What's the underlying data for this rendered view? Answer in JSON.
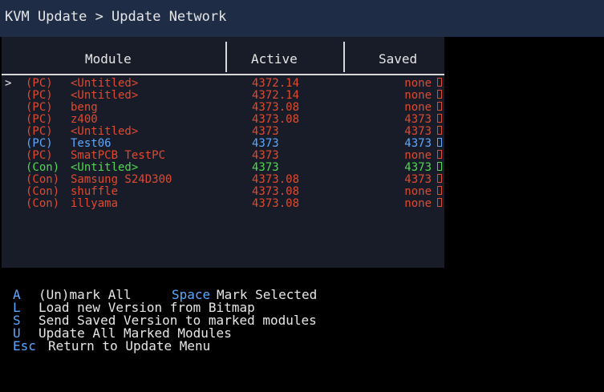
{
  "title": "KVM Update > Update Network",
  "columns": {
    "module": "Module",
    "active": "Active",
    "saved": "Saved"
  },
  "cursor": ">",
  "rows": [
    {
      "type": "(PC)",
      "name": "<Untitled>",
      "active": "4372.14",
      "saved": "none",
      "color": "#e04a2e"
    },
    {
      "type": "(PC)",
      "name": "<Untitled>",
      "active": "4372.14",
      "saved": "none",
      "color": "#e04a2e"
    },
    {
      "type": "(PC)",
      "name": "beng",
      "active": "4373.08",
      "saved": "none",
      "color": "#e04a2e"
    },
    {
      "type": "(PC)",
      "name": "z400",
      "active": "4373.08",
      "saved": "4373",
      "color": "#e04a2e"
    },
    {
      "type": "(PC)",
      "name": "<Untitled>",
      "active": "4373",
      "saved": "4373",
      "color": "#e04a2e"
    },
    {
      "type": "(PC)",
      "name": "Test06",
      "active": "4373",
      "saved": "4373",
      "color": "#5aa8ff"
    },
    {
      "type": "(PC)",
      "name": "SmatPCB TestPC",
      "active": "4373",
      "saved": "none",
      "color": "#e04a2e"
    },
    {
      "type": "(Con)",
      "name": "<Untitled>",
      "active": "4373",
      "saved": "4373",
      "color": "#4fd84f"
    },
    {
      "type": "(Con)",
      "name": "Samsung S24D300",
      "active": "4373.08",
      "saved": "4373",
      "color": "#e04a2e"
    },
    {
      "type": "(Con)",
      "name": "shuffle",
      "active": "4373.08",
      "saved": "none",
      "color": "#e04a2e"
    },
    {
      "type": "(Con)",
      "name": "illyama",
      "active": "4373.08",
      "saved": "none",
      "color": "#e04a2e"
    }
  ],
  "help": [
    {
      "key": "A",
      "desc": "(Un)mark All",
      "key2": "Space",
      "desc2": "Mark Selected"
    },
    {
      "key": "L",
      "desc": "Load new Version from Bitmap"
    },
    {
      "key": "S",
      "desc": "Send Saved Version to marked modules"
    },
    {
      "key": "U",
      "desc": "Update All Marked Modules"
    }
  ],
  "esc": {
    "key": "Esc",
    "desc": "Return to Update Menu"
  },
  "colors": {
    "title_bg": "#1f2c45",
    "panel_bg": "#181c28",
    "key": "#5aa8ff"
  }
}
